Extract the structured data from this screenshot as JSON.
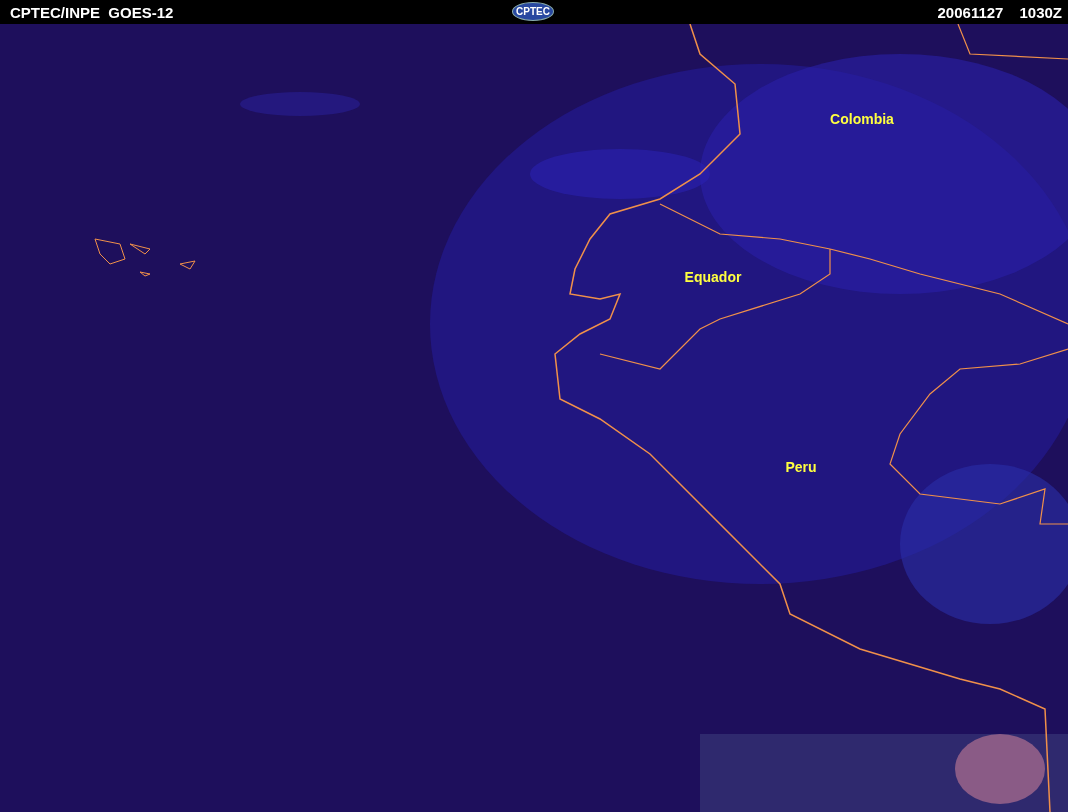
{
  "header": {
    "title": "CPTEC/INPE  GOES-12",
    "logo": "CPTEC",
    "date": "20061127",
    "time": "1030Z"
  },
  "map": {
    "labels": [
      "Colombia",
      "Equador",
      "Peru"
    ]
  }
}
